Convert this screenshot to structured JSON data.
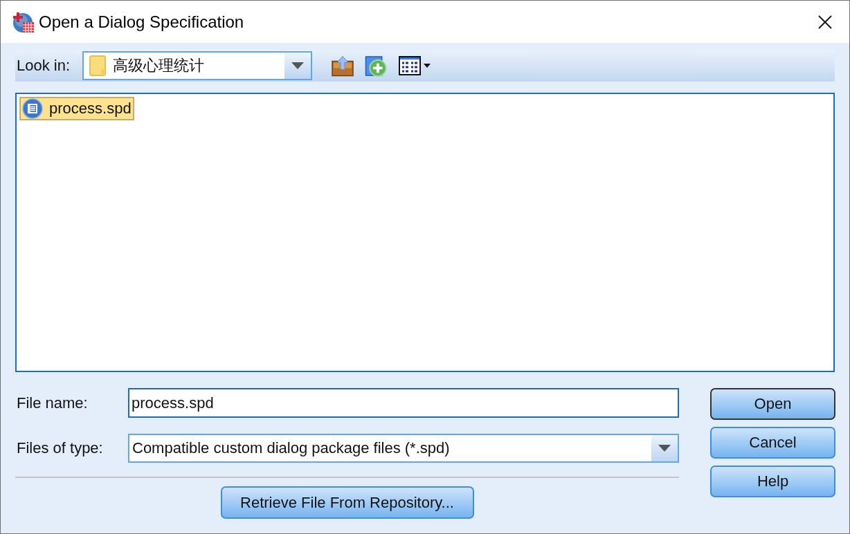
{
  "window": {
    "title": "Open a Dialog Specification"
  },
  "look_in": {
    "label": "Look in:",
    "value": "高级心理统计"
  },
  "files": [
    {
      "name": "process.spd",
      "selected": true
    }
  ],
  "file_name": {
    "label": "File name:",
    "value": "process.spd"
  },
  "file_type": {
    "label": "Files of type:",
    "value": "Compatible custom dialog package files (*.spd)"
  },
  "retrieve_button": "Retrieve File From Repository...",
  "buttons": [
    {
      "label": "Open",
      "default": true
    },
    {
      "label": "Cancel",
      "default": false
    },
    {
      "label": "Help",
      "default": false
    }
  ]
}
